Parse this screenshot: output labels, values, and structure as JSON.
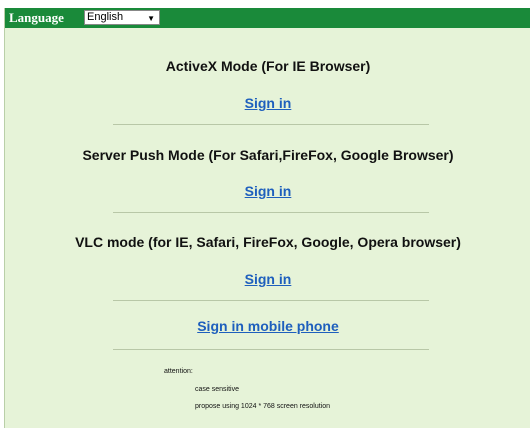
{
  "header": {
    "language_label": "Language",
    "language_selected": "English"
  },
  "sections": [
    {
      "title": "ActiveX Mode (For IE Browser)",
      "link": "Sign in"
    },
    {
      "title": "Server Push Mode (For Safari,FireFox, Google Browser)",
      "link": "Sign in"
    },
    {
      "title": "VLC mode (for IE, Safari, FireFox, Google, Opera browser)",
      "link": "Sign in"
    }
  ],
  "mobile": {
    "link": "Sign in mobile phone"
  },
  "attention": {
    "title": "attention:",
    "items": [
      "case sensitive",
      "propose using 1024 * 768 screen resolution"
    ]
  },
  "colors": {
    "header_bg": "#1a8a3a",
    "page_bg": "#e6f3d8",
    "link": "#1e5fbd"
  }
}
